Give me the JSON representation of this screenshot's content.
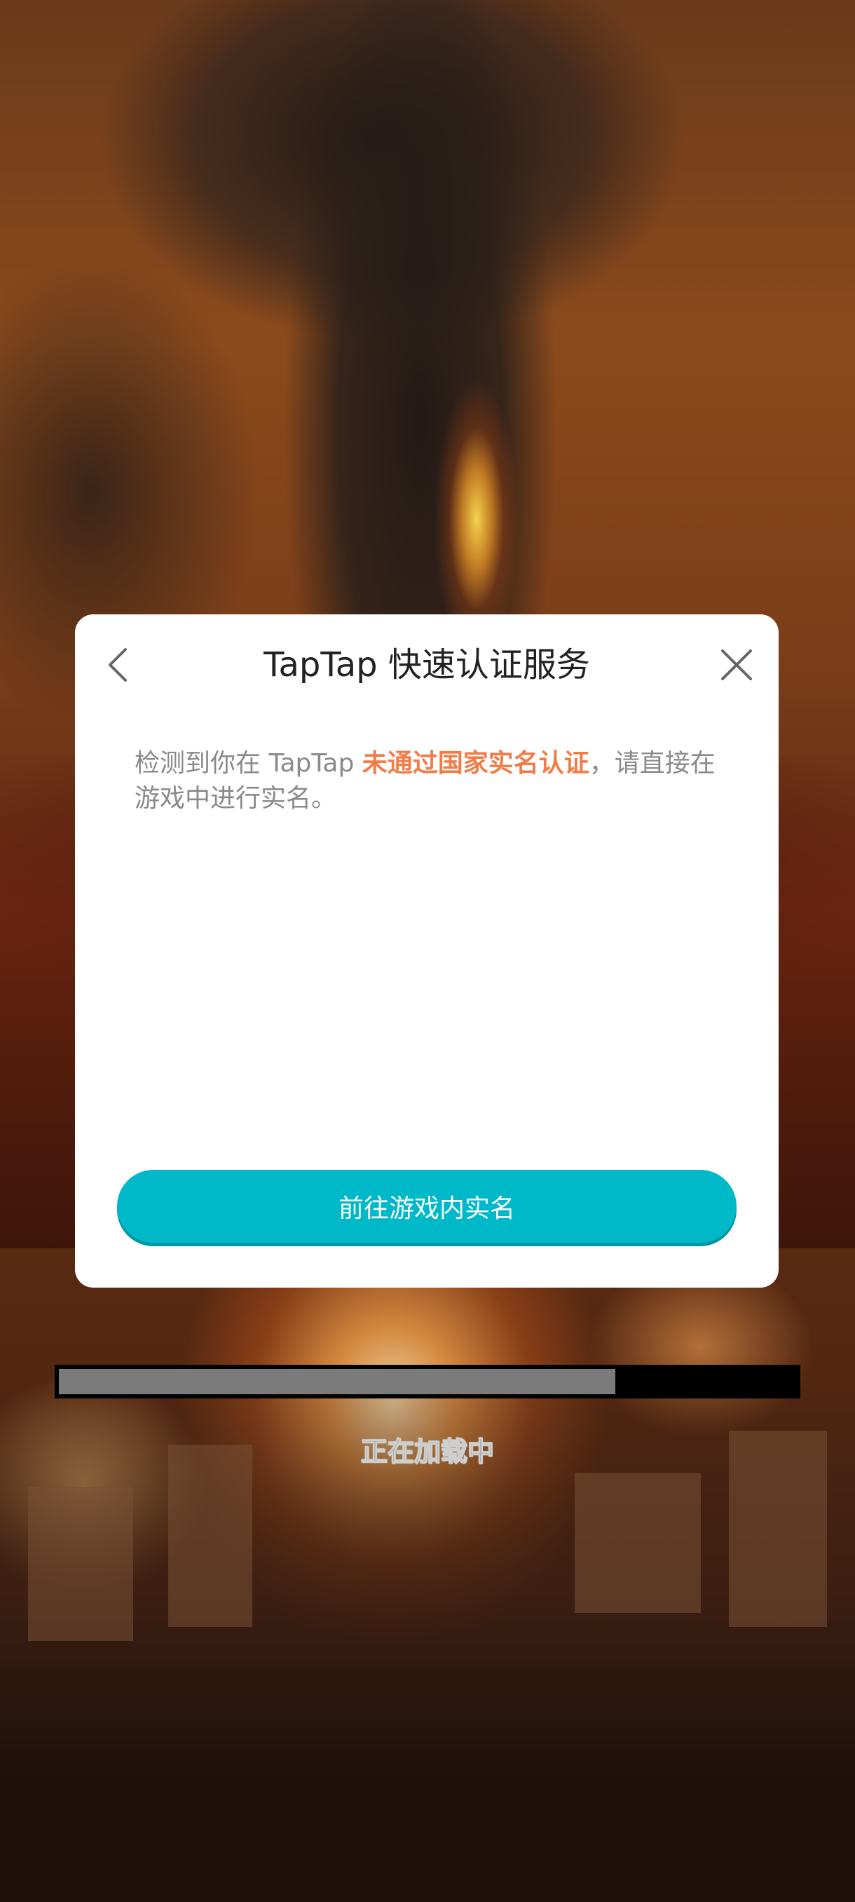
{
  "dialog": {
    "title": "TapTap 快速认证服务",
    "message_prefix": "检测到你在 TapTap ",
    "message_highlight": "未通过国家实名认证",
    "message_suffix": "，请直接在游戏中进行实名。",
    "primary_button_label": "前往游戏内实名",
    "back_icon": "chevron-left-icon",
    "close_icon": "close-icon",
    "highlight_color": "#f07c47",
    "button_color": "#00b9c8"
  },
  "loading": {
    "progress_fraction": 0.755,
    "status_text": "正在加载中"
  }
}
